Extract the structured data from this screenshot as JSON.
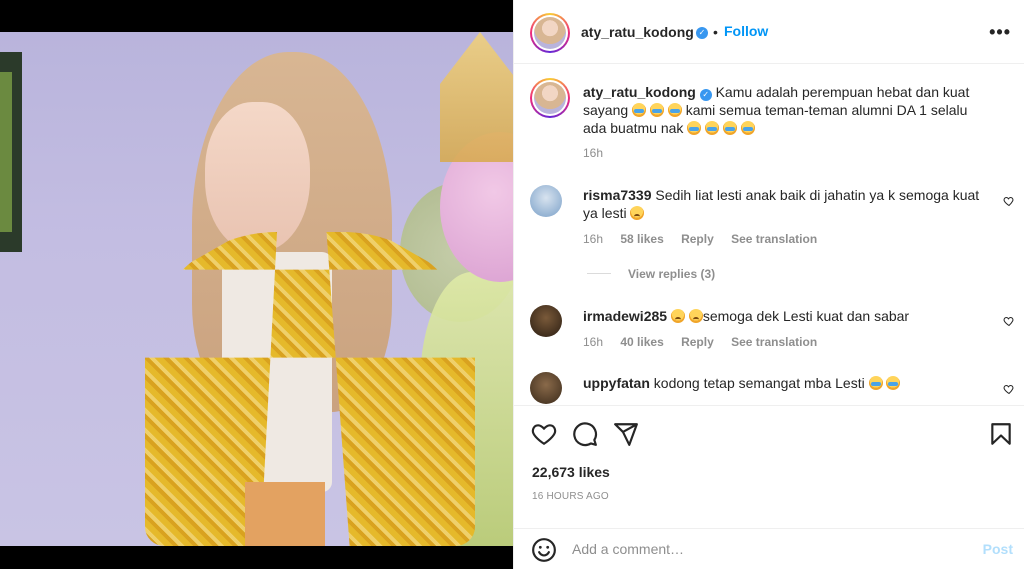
{
  "post": {
    "username": "aty_ratu_kodong",
    "follow_label": "Follow",
    "separator": "•",
    "more_label": "•••"
  },
  "caption": {
    "username": "aty_ratu_kodong",
    "text_part1": "Kamu adalah perempuan hebat dan kuat sayang",
    "text_part2": "kami semua teman-teman alumni DA 1 selalu ada buatmu nak",
    "time": "16h"
  },
  "comments": [
    {
      "username": "risma7339",
      "text": "Sedih liat lesti anak baik di jahatin ya k semoga kuat ya lesti",
      "time": "16h",
      "likes": "58 likes",
      "reply": "Reply",
      "translate": "See translation"
    },
    {
      "username": "irmadewi285",
      "text": "semoga dek Lesti kuat dan sabar",
      "time": "16h",
      "likes": "40 likes",
      "reply": "Reply",
      "translate": "See translation"
    },
    {
      "username": "uppyfatan",
      "text": "kodong tetap semangat mba Lesti"
    }
  ],
  "view_replies": "View replies (3)",
  "footer": {
    "likes": "22,673 likes",
    "time_ago": "16 HOURS AGO",
    "comment_placeholder": "Add a comment…",
    "post_label": "Post"
  },
  "icons": {
    "like": "heart-icon",
    "comment": "comment-icon",
    "share": "paper-plane-icon",
    "save": "bookmark-icon",
    "emoji": "smiley-icon",
    "verified": "verified-badge-icon",
    "more": "more-options-icon",
    "comment_like": "small-heart-icon"
  },
  "colors": {
    "link_blue": "#0095f6",
    "verified_blue": "#3897f0",
    "muted": "#8e8e8e",
    "post_disabled": "#b2dffc"
  }
}
